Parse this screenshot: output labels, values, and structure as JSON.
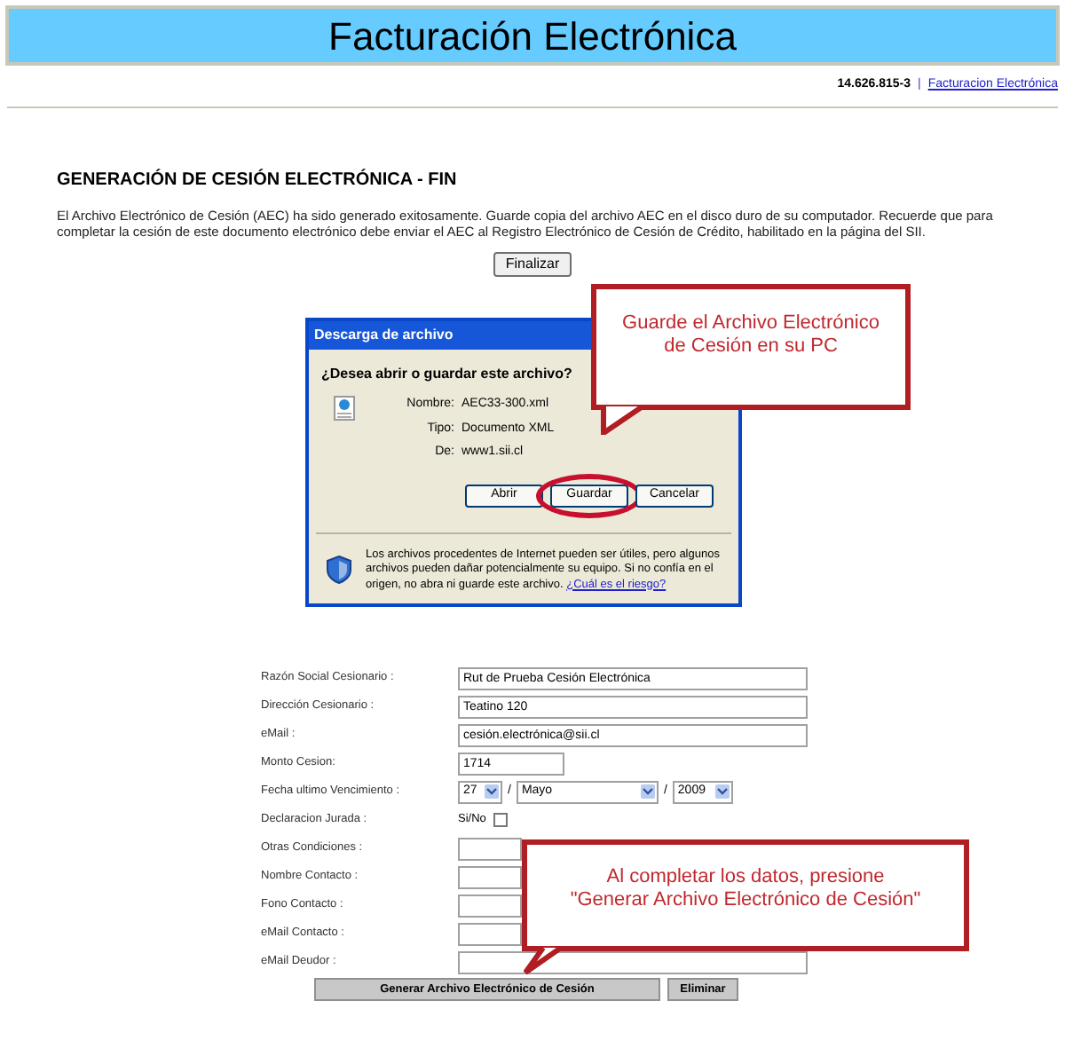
{
  "header": {
    "title": "Facturación Electrónica"
  },
  "user_bar": {
    "rut": "14.626.815-3",
    "separator": "|",
    "link": "Facturacion Electrónica"
  },
  "heading": "GENERACIÓN DE CESIÓN ELECTRÓNICA - FIN",
  "message": "El Archivo Electrónico de Cesión (AEC) ha sido generado exitosamente. Guarde copia del archivo AEC en el disco duro de su computador. Recuerde que para completar la cesión de este documento electrónico debe enviar el AEC al Registro Electrónico de Cesión de Crédito, habilitado en la página del SII.",
  "finish_button": "Finalizar",
  "dialog": {
    "title": "Descarga de archivo",
    "question": "¿Desea abrir o guardar este archivo?",
    "details": [
      {
        "label": "Nombre:",
        "value": "AEC33-300.xml"
      },
      {
        "label": "Tipo:",
        "value": "Documento XML"
      },
      {
        "label": "De:",
        "value": "www1.sii.cl"
      }
    ],
    "buttons": [
      {
        "label": "Abrir",
        "highlighted": false
      },
      {
        "label": "Guardar",
        "highlighted": true
      },
      {
        "label": "Cancelar",
        "highlighted": false
      }
    ],
    "warning": "Los archivos procedentes de Internet pueden ser útiles, pero algunos archivos pueden dañar potencialmente su equipo. Si no confía en el origen, no abra ni guarde este archivo.",
    "warning_link": "¿Cuál es el riesgo?"
  },
  "callouts": [
    {
      "text": "Guarde el Archivo Electrónico de Cesión en su PC"
    },
    {
      "text": "Al completar los datos, presione \"Generar Archivo Electrónico de Cesión\""
    }
  ],
  "form": {
    "rows": [
      {
        "kind": "text",
        "label": "Razón Social Cesionario :",
        "value": "Rut de Prueba Cesión Electrónica"
      },
      {
        "kind": "text",
        "label": "Dirección Cesionario :",
        "value": "Teatino 120"
      },
      {
        "kind": "text",
        "label": "eMail :",
        "value": "cesión.electrónica@sii.cl"
      },
      {
        "kind": "text",
        "label": "Monto Cesion:",
        "value": "1714"
      },
      {
        "kind": "date",
        "label": "Fecha ultimo Vencimiento :",
        "day": "27",
        "month": "Mayo",
        "year": "2009",
        "separator": "/"
      },
      {
        "kind": "checkbox",
        "label": "Declaracion Jurada :",
        "option": "Si/No",
        "checked": false
      },
      {
        "kind": "text",
        "label": "Otras Condiciones :"
      },
      {
        "kind": "text",
        "label": "Nombre Contacto :"
      },
      {
        "kind": "text",
        "label": "Fono Contacto :"
      },
      {
        "kind": "text",
        "label": "eMail Contacto :"
      },
      {
        "kind": "text",
        "label": "eMail Deudor :"
      }
    ],
    "buttons": [
      "Generar Archivo Electrónico de Cesión",
      "Eliminar"
    ]
  }
}
